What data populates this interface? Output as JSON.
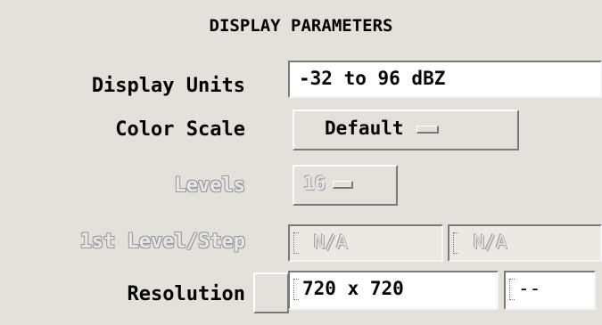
{
  "panel": {
    "title": "DISPLAY PARAMETERS"
  },
  "rows": {
    "display_units": {
      "label": "Display Units",
      "value": "-32 to 96 dBZ"
    },
    "color_scale": {
      "label": "Color Scale",
      "value": "Default"
    },
    "levels": {
      "label": "Levels",
      "value": "16"
    },
    "first_level_step": {
      "label": "1st Level/Step",
      "level": "N/A",
      "step": "N/A"
    },
    "resolution": {
      "label": "Resolution",
      "value": "720 x 720",
      "secondary": "--"
    }
  }
}
